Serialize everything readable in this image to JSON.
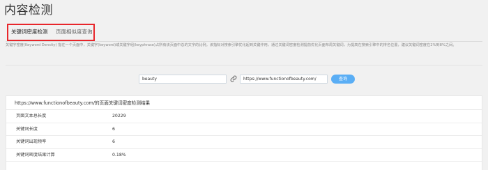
{
  "page": {
    "title": "内容检测"
  },
  "tabs": [
    {
      "label": "关键词密度检测",
      "active": true
    },
    {
      "label": "页面相似度查询",
      "active": false
    }
  ],
  "description": "关键字密度(Keyword Density) 指在一个页面中，关键字(keyword)或关键字组(keyphrase)占所有该页面中总的文字的比例。该指标对搜索引擎优化起到关键作用，通过关键词密度检测提前优化页面布局关键词，为提高在搜索引擎中的排名位置，建议关键词密度在2%到8%之间。",
  "search": {
    "keyword_value": "beauty",
    "url_value": "https://www.functionofbeauty.com/",
    "query_label": "查询"
  },
  "result": {
    "header": "https://www.functionofbeauty.com/的页面关键词密度检测结果",
    "rows": [
      {
        "label": "页面文本总长度",
        "value": "20229"
      },
      {
        "label": "关键词长度",
        "value": "6"
      },
      {
        "label": "关键词出现频率",
        "value": "6"
      },
      {
        "label": "关键词密度结果计算",
        "value": "0.18%"
      }
    ]
  },
  "colors": {
    "highlight_border": "#e8262b",
    "button": "#5aaef5",
    "background": "#f1f1f1"
  }
}
